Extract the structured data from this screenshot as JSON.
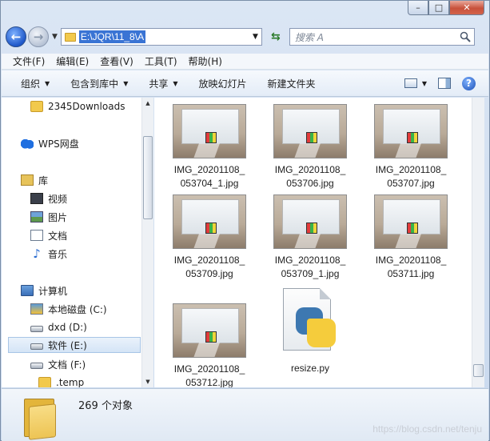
{
  "window": {
    "min_label": "–",
    "max_label": "□",
    "close_label": "✕"
  },
  "address": {
    "path": "E:\\JQR\\11_8\\A",
    "search_placeholder": "搜索 A"
  },
  "menubar": {
    "items": [
      "文件(F)",
      "编辑(E)",
      "查看(V)",
      "工具(T)",
      "帮助(H)"
    ]
  },
  "toolbar": {
    "organize": "组织",
    "include_in_library": "包含到库中",
    "share": "共享",
    "slideshow": "放映幻灯片",
    "new_folder": "新建文件夹",
    "help": "?"
  },
  "nav": {
    "items": [
      {
        "label": "2345Downloads",
        "icon": "folder-icon"
      },
      {
        "label": "WPS网盘",
        "icon": "cloud-icon"
      },
      {
        "label": "库",
        "icon": "library-icon"
      },
      {
        "label": "视频",
        "icon": "video-icon"
      },
      {
        "label": "图片",
        "icon": "picture-icon"
      },
      {
        "label": "文档",
        "icon": "document-icon"
      },
      {
        "label": "音乐",
        "icon": "music-icon"
      },
      {
        "label": "计算机",
        "icon": "computer-icon"
      },
      {
        "label": "本地磁盘 (C:)",
        "icon": "system-drive-icon"
      },
      {
        "label": "dxd (D:)",
        "icon": "drive-icon"
      },
      {
        "label": "软件 (E:)",
        "icon": "drive-icon"
      },
      {
        "label": "文档 (F:)",
        "icon": "drive-icon"
      },
      {
        "label": ".temp",
        "icon": "folder-icon"
      }
    ]
  },
  "files": [
    {
      "line1": "IMG_20201108_",
      "line2": "053704_1.jpg"
    },
    {
      "line1": "IMG_20201108_",
      "line2": "053706.jpg"
    },
    {
      "line1": "IMG_20201108_",
      "line2": "053707.jpg"
    },
    {
      "line1": "IMG_20201108_",
      "line2": "053709.jpg"
    },
    {
      "line1": "IMG_20201108_",
      "line2": "053709_1.jpg"
    },
    {
      "line1": "IMG_20201108_",
      "line2": "053711.jpg"
    },
    {
      "line1": "IMG_20201108_",
      "line2": "053712.jpg"
    },
    {
      "line1": "resize.py",
      "line2": ""
    }
  ],
  "status": {
    "object_count": "269 个对象",
    "watermark": "https://blog.csdn.net/tenju"
  }
}
